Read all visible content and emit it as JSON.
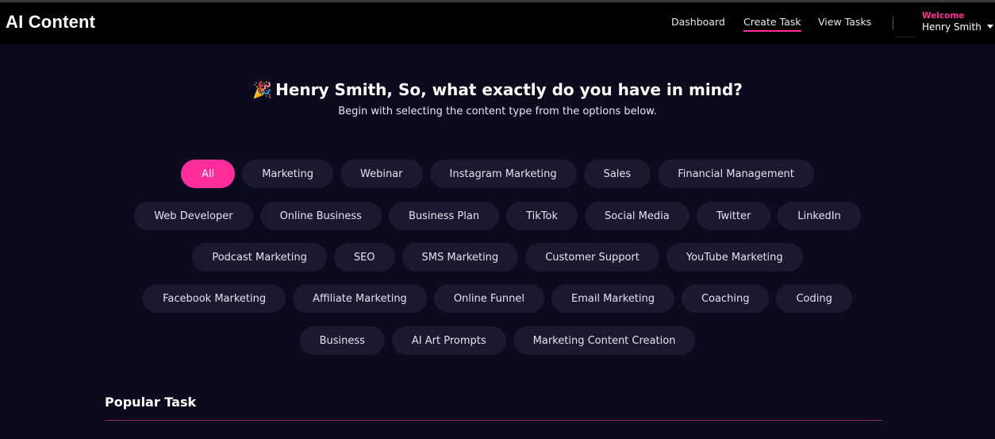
{
  "app": {
    "title": "AI Content"
  },
  "nav": {
    "links": [
      {
        "label": "Dashboard",
        "active": false
      },
      {
        "label": "Create Task",
        "active": true
      },
      {
        "label": "View Tasks",
        "active": false
      }
    ],
    "welcome": "Welcome",
    "user_name": "Henry Smith"
  },
  "hero": {
    "title": "Henry Smith, So, what exactly do you have in mind?",
    "subtitle": "Begin with selecting the content type from the options below."
  },
  "categories": [
    [
      "All",
      "Marketing",
      "Webinar",
      "Instagram Marketing",
      "Sales",
      "Financial Management"
    ],
    [
      "Web Developer",
      "Online Business",
      "Business Plan",
      "TikTok",
      "Social Media",
      "Twitter",
      "LinkedIn"
    ],
    [
      "Podcast Marketing",
      "SEO",
      "SMS Marketing",
      "Customer Support",
      "YouTube Marketing"
    ],
    [
      "Facebook Marketing",
      "Affiliate Marketing",
      "Online Funnel",
      "Email Marketing",
      "Coaching",
      "Coding"
    ],
    [
      "Business",
      "AI Art Prompts",
      "Marketing Content Creation"
    ]
  ],
  "selected_category": "All",
  "popular": {
    "title": "Popular Task"
  },
  "colors": {
    "accent": "#ff2d9b",
    "background": "#0c0b1e",
    "chip": "#1b1830"
  }
}
